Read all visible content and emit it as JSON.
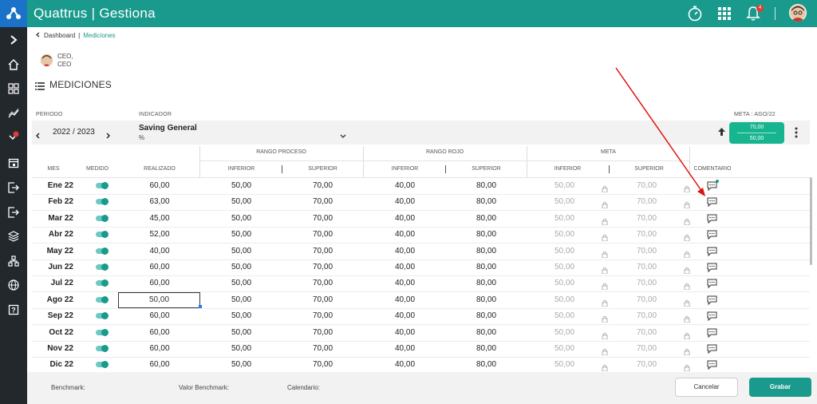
{
  "app": {
    "brand": "Quattrus",
    "separator": "|",
    "module": "Gestiona",
    "notification_count": "4"
  },
  "breadcrumb": {
    "parent": "Dashboard",
    "separator": "|",
    "current": "Mediciones"
  },
  "user": {
    "line1": "CEO,",
    "line2": "CEO"
  },
  "page": {
    "title": "MEDICIONES"
  },
  "filters": {
    "periodo_label": "PERIODO",
    "periodo_value": "2022 / 2023",
    "indicador_label": "INDICADOR",
    "indicador_name": "Saving General",
    "indicador_unit": "%",
    "meta_label": "META : AGO/22",
    "meta_upper": "70,00",
    "meta_lower": "50,00"
  },
  "groups": {
    "rango_proceso": "RANGO PROCESO",
    "rango_rojo": "RANGO ROJO",
    "meta": "META"
  },
  "columns": {
    "mes": "MES",
    "medido": "MEDIDO",
    "realizado": "REALIZADO",
    "inferior1": "INFERIOR",
    "superior1": "SUPERIOR",
    "inferior2": "INFERIOR",
    "superior2": "SUPERIOR",
    "inferior3": "INFERIOR",
    "superior3": "SUPERIOR",
    "comentario": "COMENTARIO"
  },
  "rows": [
    {
      "mes": "Ene 22",
      "realizado": "60,00",
      "rp_inf": "50,00",
      "rp_sup": "70,00",
      "rr_inf": "40,00",
      "rr_sup": "80,00",
      "m_inf": "50,00",
      "m_sup": "70,00"
    },
    {
      "mes": "Feb 22",
      "realizado": "63,00",
      "rp_inf": "50,00",
      "rp_sup": "70,00",
      "rr_inf": "40,00",
      "rr_sup": "80,00",
      "m_inf": "50,00",
      "m_sup": "70,00"
    },
    {
      "mes": "Mar 22",
      "realizado": "45,00",
      "rp_inf": "50,00",
      "rp_sup": "70,00",
      "rr_inf": "40,00",
      "rr_sup": "80,00",
      "m_inf": "50,00",
      "m_sup": "70,00"
    },
    {
      "mes": "Abr 22",
      "realizado": "52,00",
      "rp_inf": "50,00",
      "rp_sup": "70,00",
      "rr_inf": "40,00",
      "rr_sup": "80,00",
      "m_inf": "50,00",
      "m_sup": "70,00"
    },
    {
      "mes": "May 22",
      "realizado": "40,00",
      "rp_inf": "50,00",
      "rp_sup": "70,00",
      "rr_inf": "40,00",
      "rr_sup": "80,00",
      "m_inf": "50,00",
      "m_sup": "70,00"
    },
    {
      "mes": "Jun 22",
      "realizado": "60,00",
      "rp_inf": "50,00",
      "rp_sup": "70,00",
      "rr_inf": "40,00",
      "rr_sup": "80,00",
      "m_inf": "50,00",
      "m_sup": "70,00"
    },
    {
      "mes": "Jul 22",
      "realizado": "60,00",
      "rp_inf": "50,00",
      "rp_sup": "70,00",
      "rr_inf": "40,00",
      "rr_sup": "80,00",
      "m_inf": "50,00",
      "m_sup": "70,00"
    },
    {
      "mes": "Ago 22",
      "realizado": "50,00",
      "rp_inf": "50,00",
      "rp_sup": "70,00",
      "rr_inf": "40,00",
      "rr_sup": "80,00",
      "m_inf": "50,00",
      "m_sup": "70,00"
    },
    {
      "mes": "Sep 22",
      "realizado": "60,00",
      "rp_inf": "50,00",
      "rp_sup": "70,00",
      "rr_inf": "40,00",
      "rr_sup": "80,00",
      "m_inf": "50,00",
      "m_sup": "70,00"
    },
    {
      "mes": "Oct 22",
      "realizado": "60,00",
      "rp_inf": "50,00",
      "rp_sup": "70,00",
      "rr_inf": "40,00",
      "rr_sup": "80,00",
      "m_inf": "50,00",
      "m_sup": "70,00"
    },
    {
      "mes": "Nov 22",
      "realizado": "60,00",
      "rp_inf": "50,00",
      "rp_sup": "70,00",
      "rr_inf": "40,00",
      "rr_sup": "80,00",
      "m_inf": "50,00",
      "m_sup": "70,00"
    },
    {
      "mes": "Dic 22",
      "realizado": "60,00",
      "rp_inf": "50,00",
      "rp_sup": "70,00",
      "rr_inf": "40,00",
      "rr_sup": "80,00",
      "m_inf": "50,00",
      "m_sup": "70,00"
    }
  ],
  "footer": {
    "benchmark_label": "Benchmark:",
    "valor_benchmark_label": "Valor Benchmark:",
    "calendario_label": "Calendario:",
    "cancel_label": "Cancelar",
    "save_label": "Grabar"
  },
  "colors": {
    "primary": "#1a9a8c",
    "logo_blue": "#1a73c8",
    "sidebar": "#23282d",
    "meta_green": "#17b58f",
    "annotation_red": "#e01010"
  }
}
